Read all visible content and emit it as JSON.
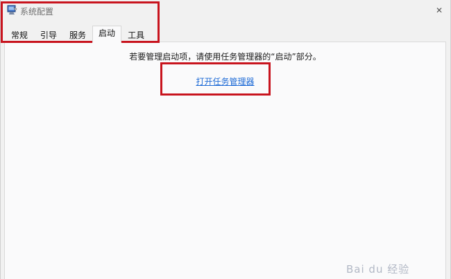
{
  "window": {
    "title": "系统配置",
    "icon": "msconfig-icon",
    "close_glyph": "✕"
  },
  "tabs": [
    {
      "label": "常规",
      "active": false
    },
    {
      "label": "引导",
      "active": false
    },
    {
      "label": "服务",
      "active": false
    },
    {
      "label": "启动",
      "active": true
    },
    {
      "label": "工具",
      "active": false
    }
  ],
  "startup": {
    "instruction": "若要管理启动项，请使用任务管理器的“启动”部分。",
    "link_label": "打开任务管理器"
  },
  "annotation": {
    "highlight_color": "#c8141e"
  },
  "watermark": {
    "text": "Bai du 经验"
  }
}
